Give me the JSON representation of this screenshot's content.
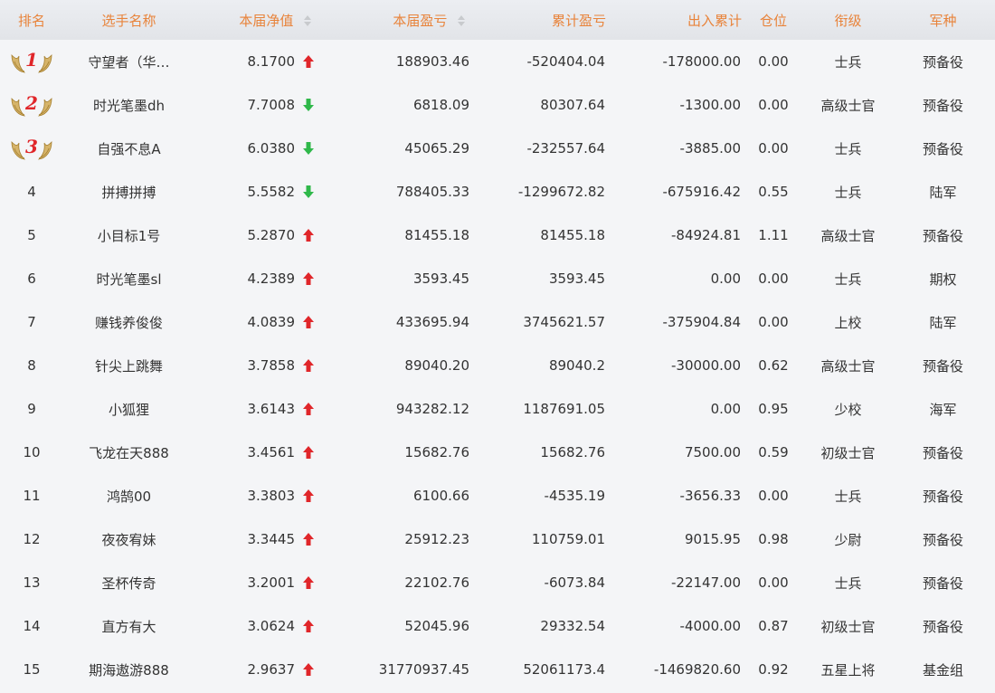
{
  "colors": {
    "header_text": "#e8833a",
    "up": "#e0262a",
    "down": "#2fb84a",
    "badge_text": "#e0262a",
    "wing": "#c9a24a"
  },
  "headers": {
    "rank": "排名",
    "name": "选手名称",
    "net_value": "本届净值",
    "profit": "本届盈亏",
    "cum_profit": "累计盈亏",
    "inout": "出入累计",
    "position": "仓位",
    "title": "衔级",
    "branch": "军种"
  },
  "rows": [
    {
      "rank": "1",
      "name": "守望者（华…",
      "nv": "8.1700",
      "trend": "up",
      "profit": "188903.46",
      "cum": "-520404.04",
      "inout": "-178000.00",
      "pos": "0.00",
      "title": "士兵",
      "branch": "预备役"
    },
    {
      "rank": "2",
      "name": "时光笔墨dh",
      "nv": "7.7008",
      "trend": "down",
      "profit": "6818.09",
      "cum": "80307.64",
      "inout": "-1300.00",
      "pos": "0.00",
      "title": "高级士官",
      "branch": "预备役"
    },
    {
      "rank": "3",
      "name": "自强不息A",
      "nv": "6.0380",
      "trend": "down",
      "profit": "45065.29",
      "cum": "-232557.64",
      "inout": "-3885.00",
      "pos": "0.00",
      "title": "士兵",
      "branch": "预备役"
    },
    {
      "rank": "4",
      "name": "拼搏拼搏",
      "nv": "5.5582",
      "trend": "down",
      "profit": "788405.33",
      "cum": "-1299672.82",
      "inout": "-675916.42",
      "pos": "0.55",
      "title": "士兵",
      "branch": "陆军"
    },
    {
      "rank": "5",
      "name": "小目标1号",
      "nv": "5.2870",
      "trend": "up",
      "profit": "81455.18",
      "cum": "81455.18",
      "inout": "-84924.81",
      "pos": "1.11",
      "title": "高级士官",
      "branch": "预备役"
    },
    {
      "rank": "6",
      "name": "时光笔墨sl",
      "nv": "4.2389",
      "trend": "up",
      "profit": "3593.45",
      "cum": "3593.45",
      "inout": "0.00",
      "pos": "0.00",
      "title": "士兵",
      "branch": "期权"
    },
    {
      "rank": "7",
      "name": "赚钱养俊俊",
      "nv": "4.0839",
      "trend": "up",
      "profit": "433695.94",
      "cum": "3745621.57",
      "inout": "-375904.84",
      "pos": "0.00",
      "title": "上校",
      "branch": "陆军"
    },
    {
      "rank": "8",
      "name": "针尖上跳舞",
      "nv": "3.7858",
      "trend": "up",
      "profit": "89040.20",
      "cum": "89040.2",
      "inout": "-30000.00",
      "pos": "0.62",
      "title": "高级士官",
      "branch": "预备役"
    },
    {
      "rank": "9",
      "name": "小狐狸",
      "nv": "3.6143",
      "trend": "up",
      "profit": "943282.12",
      "cum": "1187691.05",
      "inout": "0.00",
      "pos": "0.95",
      "title": "少校",
      "branch": "海军"
    },
    {
      "rank": "10",
      "name": "飞龙在天888",
      "nv": "3.4561",
      "trend": "up",
      "profit": "15682.76",
      "cum": "15682.76",
      "inout": "7500.00",
      "pos": "0.59",
      "title": "初级士官",
      "branch": "预备役"
    },
    {
      "rank": "11",
      "name": "鸿鹄00",
      "nv": "3.3803",
      "trend": "up",
      "profit": "6100.66",
      "cum": "-4535.19",
      "inout": "-3656.33",
      "pos": "0.00",
      "title": "士兵",
      "branch": "预备役"
    },
    {
      "rank": "12",
      "name": "夜夜宥妹",
      "nv": "3.3445",
      "trend": "up",
      "profit": "25912.23",
      "cum": "110759.01",
      "inout": "9015.95",
      "pos": "0.98",
      "title": "少尉",
      "branch": "预备役"
    },
    {
      "rank": "13",
      "name": "圣杯传奇",
      "nv": "3.2001",
      "trend": "up",
      "profit": "22102.76",
      "cum": "-6073.84",
      "inout": "-22147.00",
      "pos": "0.00",
      "title": "士兵",
      "branch": "预备役"
    },
    {
      "rank": "14",
      "name": "直方有大",
      "nv": "3.0624",
      "trend": "up",
      "profit": "52045.96",
      "cum": "29332.54",
      "inout": "-4000.00",
      "pos": "0.87",
      "title": "初级士官",
      "branch": "预备役"
    },
    {
      "rank": "15",
      "name": "期海遨游888",
      "nv": "2.9637",
      "trend": "up",
      "profit": "31770937.45",
      "cum": "52061173.4",
      "inout": "-1469820.60",
      "pos": "0.92",
      "title": "五星上将",
      "branch": "基金组"
    }
  ]
}
